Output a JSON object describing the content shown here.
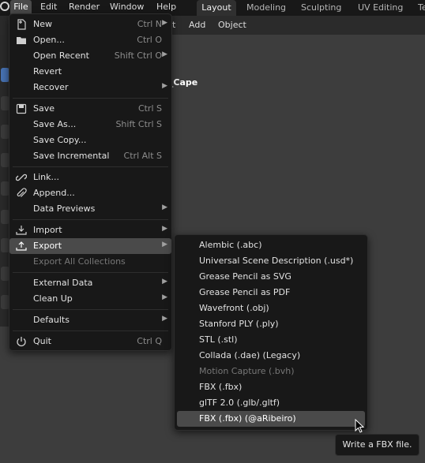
{
  "top_menu": [
    "File",
    "Edit",
    "Render",
    "Window",
    "Help"
  ],
  "workspace_tabs": [
    "Layout",
    "Modeling",
    "Sculpting",
    "UV Editing",
    "Te"
  ],
  "viewport_header": [
    "t",
    "Add",
    "Object"
  ],
  "scene_label": "er_Cape",
  "file_menu": [
    {
      "label": "New",
      "shortcut": "Ctrl N",
      "icon": "new-file-icon",
      "submenu": true
    },
    {
      "label": "Open...",
      "shortcut": "Ctrl O",
      "icon": "folder-icon"
    },
    {
      "label": "Open Recent",
      "shortcut": "Shift Ctrl O",
      "submenu": true
    },
    {
      "label": "Revert"
    },
    {
      "label": "Recover",
      "submenu": true
    },
    {
      "label": "Save",
      "shortcut": "Ctrl S",
      "icon": "save-icon"
    },
    {
      "label": "Save As...",
      "shortcut": "Shift Ctrl S"
    },
    {
      "label": "Save Copy..."
    },
    {
      "label": "Save Incremental",
      "shortcut": "Ctrl Alt S"
    },
    {
      "label": "Link...",
      "icon": "link-icon"
    },
    {
      "label": "Append...",
      "icon": "paperclip-icon"
    },
    {
      "label": "Data Previews",
      "submenu": true
    },
    {
      "label": "Import",
      "icon": "import-icon",
      "submenu": true
    },
    {
      "label": "Export",
      "icon": "export-icon",
      "submenu": true,
      "highlighted": true
    },
    {
      "label": "Export All Collections",
      "disabled": true
    },
    {
      "label": "External Data",
      "submenu": true
    },
    {
      "label": "Clean Up",
      "submenu": true
    },
    {
      "label": "Defaults",
      "submenu": true
    },
    {
      "label": "Quit",
      "shortcut": "Ctrl Q",
      "icon": "power-icon"
    }
  ],
  "export_menu": [
    {
      "label": "Alembic (.abc)"
    },
    {
      "label": "Universal Scene Description (.usd*)"
    },
    {
      "label": "Grease Pencil as SVG"
    },
    {
      "label": "Grease Pencil as PDF"
    },
    {
      "label": "Wavefront (.obj)"
    },
    {
      "label": "Stanford PLY (.ply)"
    },
    {
      "label": "STL (.stl)"
    },
    {
      "label": "Collada (.dae) (Legacy)"
    },
    {
      "label": "Motion Capture (.bvh)",
      "disabled": true
    },
    {
      "label": "FBX (.fbx)"
    },
    {
      "label": "glTF 2.0 (.glb/.gltf)"
    },
    {
      "label": "FBX (.fbx) (@aRibeiro)",
      "highlighted": true
    }
  ],
  "tooltip": "Write a FBX file.",
  "colors": {
    "highlight": "#4a4a4a",
    "menu_bg": "#181818",
    "active_tool": "#4772b3"
  }
}
